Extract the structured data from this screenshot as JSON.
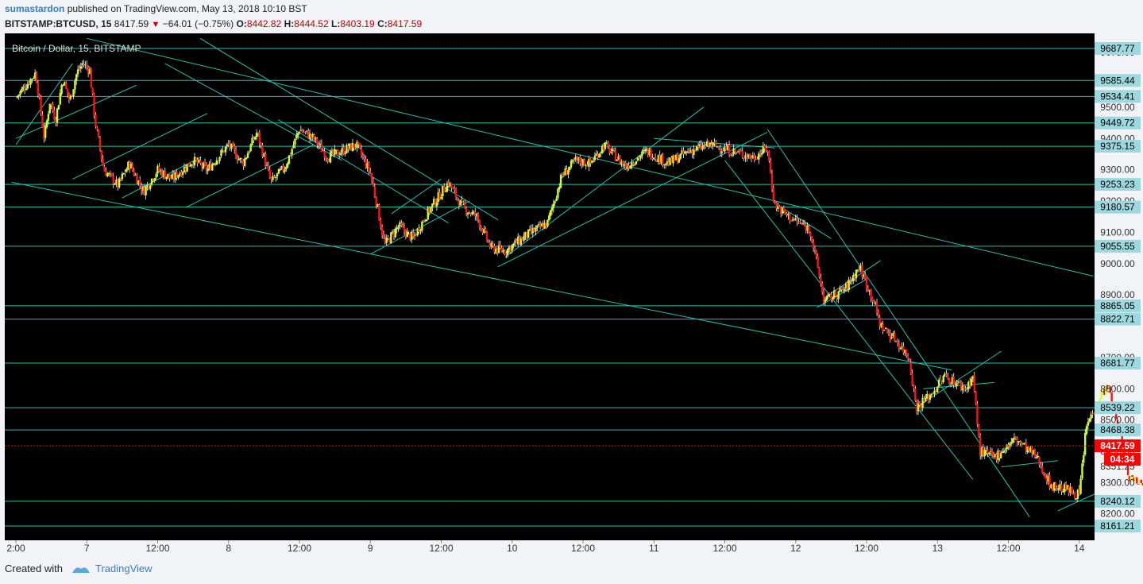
{
  "header": {
    "author": "sumastardon",
    "published": "published on TradingView.com, May 13, 2018 10:10 BST",
    "symbol": "BITSTAMP:BTCUSD, 15",
    "last": "8417.59",
    "change": "−64.01 (−0.75%)",
    "o_label": "O:",
    "o": "8442.82",
    "h_label": "H:",
    "h": "8444.52",
    "l_label": "L:",
    "l": "8403.19",
    "c_label": "C:",
    "c": "8417.59"
  },
  "chart_title": "Bitcoin / Dollar, 15, BITSTAMP",
  "footer": {
    "created_with": "Created with",
    "brand": "TradingView"
  },
  "colors": {
    "background": "#000000",
    "up": "#ccff22",
    "down": "#ff1111",
    "wick": "#ffffff",
    "trendline": "#2abfa8",
    "level_label_bg": "#9ed8df",
    "price_label_bg": "#ff0000"
  },
  "chart_data": {
    "type": "candlestick",
    "interval": "15",
    "ylim": [
      8140,
      9720
    ],
    "x_tick_labels": [
      "2:00",
      "7",
      "12:00",
      "8",
      "12:00",
      "9",
      "12:00",
      "10",
      "12:00",
      "11",
      "12:00",
      "12",
      "12:00",
      "13",
      "12:00",
      "14"
    ],
    "y_tick_labels": [
      "9675.00",
      "9500.00",
      "9400.00",
      "9300.00",
      "9200.00",
      "9100.00",
      "9000.00",
      "8900.00",
      "8700.00",
      "8600.00",
      "8500.00",
      "8400.00",
      "8351.25",
      "8300.00",
      "8200.00"
    ],
    "horizontal_levels": [
      "9687.77",
      "9585.44",
      "9534.41",
      "9449.72",
      "9375.15",
      "9253.23",
      "9180.57",
      "9055.55",
      "8865.05",
      "8822.71",
      "8681.77",
      "8539.22",
      "8468.38",
      "8240.12",
      "8161.21"
    ],
    "current_price": {
      "label": "8417.59",
      "countdown": "04:34"
    },
    "price_path": [
      {
        "t": 0.0,
        "p": 9530
      },
      {
        "t": 0.14,
        "p": 9610
      },
      {
        "t": 0.2,
        "p": 9400
      },
      {
        "t": 0.24,
        "p": 9520
      },
      {
        "t": 0.28,
        "p": 9460
      },
      {
        "t": 0.33,
        "p": 9590
      },
      {
        "t": 0.38,
        "p": 9520
      },
      {
        "t": 0.43,
        "p": 9610
      },
      {
        "t": 0.47,
        "p": 9640
      },
      {
        "t": 0.52,
        "p": 9620
      },
      {
        "t": 0.56,
        "p": 9450
      },
      {
        "t": 0.62,
        "p": 9300
      },
      {
        "t": 0.72,
        "p": 9250
      },
      {
        "t": 0.8,
        "p": 9320
      },
      {
        "t": 0.9,
        "p": 9230
      },
      {
        "t": 1.0,
        "p": 9300
      },
      {
        "t": 1.1,
        "p": 9270
      },
      {
        "t": 1.25,
        "p": 9330
      },
      {
        "t": 1.35,
        "p": 9300
      },
      {
        "t": 1.5,
        "p": 9380
      },
      {
        "t": 1.6,
        "p": 9320
      },
      {
        "t": 1.7,
        "p": 9420
      },
      {
        "t": 1.8,
        "p": 9260
      },
      {
        "t": 1.9,
        "p": 9310
      },
      {
        "t": 2.0,
        "p": 9430
      },
      {
        "t": 2.1,
        "p": 9400
      },
      {
        "t": 2.2,
        "p": 9340
      },
      {
        "t": 2.4,
        "p": 9380
      },
      {
        "t": 2.5,
        "p": 9290
      },
      {
        "t": 2.55,
        "p": 9180
      },
      {
        "t": 2.6,
        "p": 9060
      },
      {
        "t": 2.7,
        "p": 9120
      },
      {
        "t": 2.8,
        "p": 9080
      },
      {
        "t": 2.9,
        "p": 9160
      },
      {
        "t": 3.05,
        "p": 9260
      },
      {
        "t": 3.15,
        "p": 9180
      },
      {
        "t": 3.25,
        "p": 9150
      },
      {
        "t": 3.35,
        "p": 9050
      },
      {
        "t": 3.45,
        "p": 9040
      },
      {
        "t": 3.6,
        "p": 9090
      },
      {
        "t": 3.75,
        "p": 9130
      },
      {
        "t": 3.85,
        "p": 9280
      },
      {
        "t": 3.95,
        "p": 9330
      },
      {
        "t": 4.05,
        "p": 9320
      },
      {
        "t": 4.15,
        "p": 9380
      },
      {
        "t": 4.3,
        "p": 9310
      },
      {
        "t": 4.45,
        "p": 9360
      },
      {
        "t": 4.6,
        "p": 9320
      },
      {
        "t": 4.75,
        "p": 9360
      },
      {
        "t": 4.9,
        "p": 9380
      },
      {
        "t": 5.05,
        "p": 9360
      },
      {
        "t": 5.2,
        "p": 9340
      },
      {
        "t": 5.3,
        "p": 9370
      },
      {
        "t": 5.35,
        "p": 9190
      },
      {
        "t": 5.45,
        "p": 9150
      },
      {
        "t": 5.6,
        "p": 9110
      },
      {
        "t": 5.65,
        "p": 9000
      },
      {
        "t": 5.7,
        "p": 8880
      },
      {
        "t": 5.85,
        "p": 8920
      },
      {
        "t": 5.95,
        "p": 8990
      },
      {
        "t": 6.05,
        "p": 8880
      },
      {
        "t": 6.1,
        "p": 8800
      },
      {
        "t": 6.2,
        "p": 8760
      },
      {
        "t": 6.3,
        "p": 8700
      },
      {
        "t": 6.35,
        "p": 8540
      },
      {
        "t": 6.45,
        "p": 8580
      },
      {
        "t": 6.55,
        "p": 8640
      },
      {
        "t": 6.7,
        "p": 8600
      },
      {
        "t": 6.75,
        "p": 8640
      },
      {
        "t": 6.8,
        "p": 8400
      },
      {
        "t": 6.9,
        "p": 8380
      },
      {
        "t": 7.05,
        "p": 8440
      },
      {
        "t": 7.2,
        "p": 8380
      },
      {
        "t": 7.3,
        "p": 8290
      },
      {
        "t": 7.4,
        "p": 8280
      },
      {
        "t": 7.5,
        "p": 8260
      },
      {
        "t": 7.55,
        "p": 8480
      },
      {
        "t": 7.65,
        "p": 8580
      },
      {
        "t": 7.7,
        "p": 8610
      },
      {
        "t": 7.8,
        "p": 8430
      },
      {
        "t": 7.85,
        "p": 8320
      },
      {
        "t": 7.95,
        "p": 8300
      },
      {
        "t": 8.05,
        "p": 8340
      },
      {
        "t": 8.12,
        "p": 8420
      },
      {
        "t": 8.2,
        "p": 8500
      },
      {
        "t": 8.25,
        "p": 8470
      },
      {
        "t": 8.3,
        "p": 8400
      },
      {
        "t": 8.38,
        "p": 8500
      },
      {
        "t": 8.45,
        "p": 8470
      },
      {
        "t": 8.52,
        "p": 8430
      },
      {
        "t": 8.58,
        "p": 8360
      },
      {
        "t": 8.65,
        "p": 8420
      },
      {
        "t": 8.72,
        "p": 8480
      },
      {
        "t": 8.8,
        "p": 8440
      },
      {
        "t": 8.85,
        "p": 8418
      }
    ],
    "trendlines": [
      {
        "t1": -0.03,
        "p1": 9260,
        "t2": 6.6,
        "p2": 8660
      },
      {
        "t1": 0.5,
        "p1": 9720,
        "t2": 7.6,
        "p2": 8960
      },
      {
        "t1": 0.0,
        "p1": 9400,
        "t2": 0.85,
        "p2": 9570
      },
      {
        "t1": 0.4,
        "p1": 9640,
        "t2": 0.0,
        "p2": 9380
      },
      {
        "t1": 0.4,
        "p1": 9270,
        "t2": 1.35,
        "p2": 9480
      },
      {
        "t1": 0.75,
        "p1": 9210,
        "t2": 1.3,
        "p2": 9340
      },
      {
        "t1": 1.2,
        "p1": 9180,
        "t2": 2.1,
        "p2": 9380
      },
      {
        "t1": 1.3,
        "p1": 9720,
        "t2": 3.4,
        "p2": 9140
      },
      {
        "t1": 1.85,
        "p1": 9460,
        "t2": 3.05,
        "p2": 9130
      },
      {
        "t1": 1.05,
        "p1": 9640,
        "t2": 2.3,
        "p2": 9330
      },
      {
        "t1": 2.5,
        "p1": 9030,
        "t2": 3.2,
        "p2": 9200
      },
      {
        "t1": 2.65,
        "p1": 9160,
        "t2": 3.0,
        "p2": 9270
      },
      {
        "t1": 3.45,
        "p1": 9020,
        "t2": 4.85,
        "p2": 9500
      },
      {
        "t1": 3.4,
        "p1": 8990,
        "t2": 5.3,
        "p2": 9420
      },
      {
        "t1": 4.5,
        "p1": 9400,
        "t2": 5.35,
        "p2": 9370
      },
      {
        "t1": 5.3,
        "p1": 9430,
        "t2": 7.15,
        "p2": 8190
      },
      {
        "t1": 5.0,
        "p1": 9330,
        "t2": 6.75,
        "p2": 8310
      },
      {
        "t1": 5.4,
        "p1": 9180,
        "t2": 5.75,
        "p2": 9080
      },
      {
        "t1": 5.65,
        "p1": 8860,
        "t2": 6.0,
        "p2": 8950
      },
      {
        "t1": 5.7,
        "p1": 8890,
        "t2": 6.1,
        "p2": 9010
      },
      {
        "t1": 6.35,
        "p1": 8540,
        "t2": 6.95,
        "p2": 8720
      },
      {
        "t1": 6.4,
        "p1": 8600,
        "t2": 6.9,
        "p2": 8620
      },
      {
        "t1": 6.95,
        "p1": 8350,
        "t2": 7.35,
        "p2": 8370
      },
      {
        "t1": 7.35,
        "p1": 8210,
        "t2": 8.25,
        "p2": 8396
      },
      {
        "t1": 7.7,
        "p1": 8670,
        "t2": 8.65,
        "p2": 8400
      },
      {
        "t1": 8.1,
        "p1": 8625,
        "t2": 8.9,
        "p2": 8358
      },
      {
        "t1": 8.25,
        "p1": 8362,
        "t2": 8.8,
        "p2": 8405
      }
    ]
  }
}
